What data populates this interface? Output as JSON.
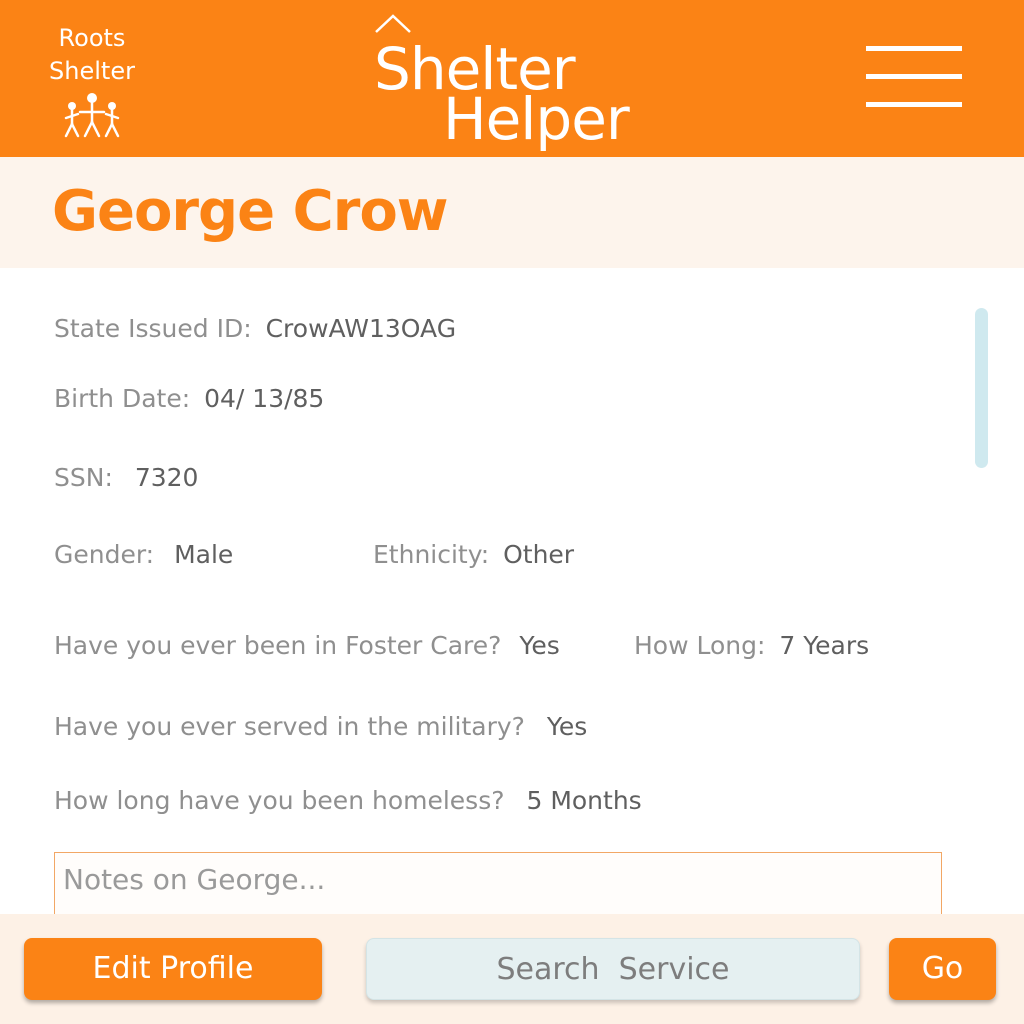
{
  "colors": {
    "brand_orange": "#fb8315",
    "name_band_bg": "#fdf4ec",
    "bottom_bar_bg": "#fdf1e6",
    "search_bg": "#e5f0f1",
    "scrollbar": "#cfe9ef",
    "label_gray": "#8f8f8f",
    "value_gray": "#5f5f5f"
  },
  "header": {
    "logo": {
      "line1": "Roots",
      "line2": "Shelter",
      "icon": "family-figures-icon"
    },
    "title": {
      "line1": "Shelter",
      "line2": "Helper",
      "icon": "roof-icon"
    },
    "menu_icon": "hamburger-menu-icon"
  },
  "profile": {
    "name": "George Crow",
    "fields": {
      "state_id": {
        "label": "State Issued ID:",
        "value": "CrowAW13OAG"
      },
      "birth_date": {
        "label": "Birth Date:",
        "value": "04/ 13/85"
      },
      "ssn": {
        "label": "SSN:",
        "value": "7320"
      },
      "gender": {
        "label": "Gender:",
        "value": "Male"
      },
      "ethnicity": {
        "label": "Ethnicity:",
        "value": "Other"
      },
      "foster_care": {
        "label": "Have you ever been in Foster Care?",
        "value": "Yes"
      },
      "foster_how_long": {
        "label": "How Long:",
        "value": "7 Years"
      },
      "military": {
        "label": "Have you ever served in the military?",
        "value": "Yes"
      },
      "homeless": {
        "label": "How long have you been homeless?",
        "value": "5 Months"
      }
    },
    "notes": {
      "placeholder": "Notes on George...",
      "value": ""
    }
  },
  "bottom_bar": {
    "edit_profile_label": "Edit Profile",
    "search_placeholder": "Search  Service",
    "go_label": "Go"
  }
}
